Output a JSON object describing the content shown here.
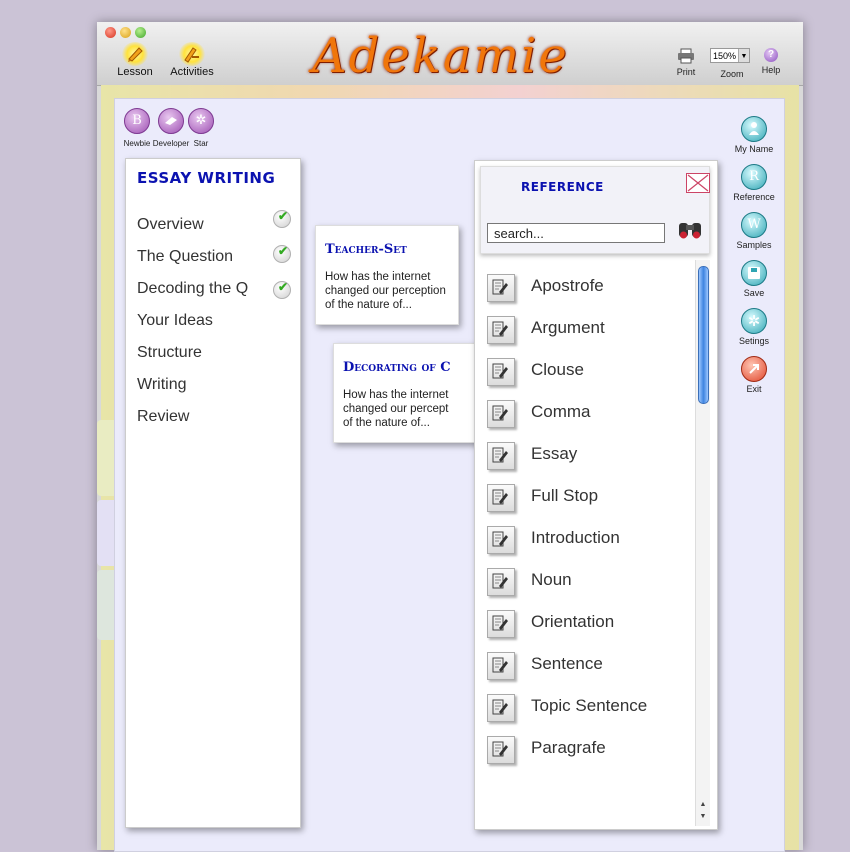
{
  "app": {
    "title": "Adekamie"
  },
  "toolbar": {
    "lesson_label": "Lesson",
    "activities_label": "Activities",
    "print_label": "Print",
    "zoom_label": "Zoom",
    "zoom_value": "150%",
    "help_label": "Help"
  },
  "user_levels": [
    {
      "glyph": "B",
      "label": "Newbie"
    },
    {
      "glyph": "",
      "label": "Developer"
    },
    {
      "glyph": "✲",
      "label": "Star"
    }
  ],
  "side_buttons": [
    {
      "label": "My Name",
      "icon": "person-icon"
    },
    {
      "label": "Reference",
      "glyph": "R"
    },
    {
      "label": "Samples",
      "glyph": "W"
    },
    {
      "label": "Save",
      "icon": "floppy-icon"
    },
    {
      "label": "Setings",
      "icon": "gear-icon"
    },
    {
      "label": "Exit",
      "icon": "exit-icon"
    }
  ],
  "lesson": {
    "title": "ESSAY WRITING",
    "items": [
      {
        "label": "Overview",
        "done": true
      },
      {
        "label": "The Question",
        "done": true
      },
      {
        "label": "Decoding the Q",
        "done": true
      },
      {
        "label": "Your Ideas",
        "done": false
      },
      {
        "label": "Structure",
        "done": false
      },
      {
        "label": "Writing",
        "done": false
      },
      {
        "label": "Review",
        "done": false
      }
    ]
  },
  "notes": [
    {
      "title": "Teacher-Set",
      "body": [
        "How has the internet",
        "changed our perception",
        "of the nature of..."
      ]
    },
    {
      "title": "Decorating of C",
      "body": [
        "How has the internet",
        "changed our percept",
        "of the nature of..."
      ]
    }
  ],
  "reference": {
    "title": "REFERENCE",
    "search_value": "search...",
    "items": [
      "Apostrofe",
      "Argument",
      "Clouse",
      "Comma",
      "Essay",
      "Full Stop",
      "Introduction",
      "Noun",
      "Orientation",
      "Sentence",
      "Topic Sentence",
      "Paragrafe"
    ]
  },
  "colors": {
    "accent_title": "#0b12b0",
    "logo": "#f0760b",
    "page_bg": "#ebebfb"
  }
}
